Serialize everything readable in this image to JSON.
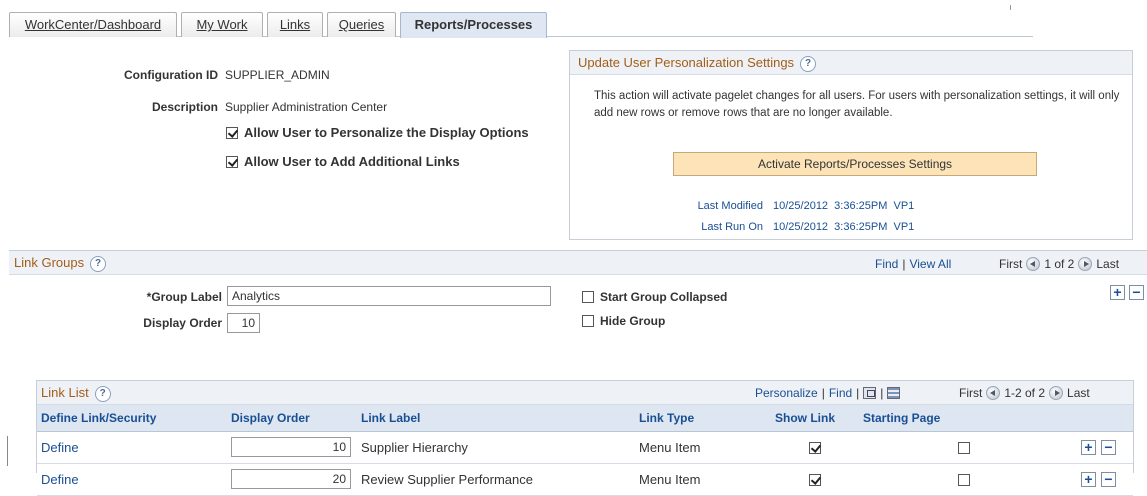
{
  "tabs": [
    {
      "label": "WorkCenter/Dashboard",
      "active": false
    },
    {
      "label": "My Work",
      "active": false
    },
    {
      "label": "Links",
      "active": false
    },
    {
      "label": "Queries",
      "active": false
    },
    {
      "label": "Reports/Processes",
      "active": true
    }
  ],
  "config": {
    "config_id_label": "Configuration ID",
    "config_id_value": "SUPPLIER_ADMIN",
    "description_label": "Description",
    "description_value": "Supplier Administration Center",
    "allow_personalize_label": "Allow User to Personalize the Display Options",
    "allow_personalize_checked": true,
    "allow_links_label": "Allow User to Add Additional Links",
    "allow_links_checked": true
  },
  "update": {
    "title": "Update User Personalization Settings",
    "help": "?",
    "description": "This action will activate pagelet changes for all users.  For users with personalization settings, it will only add new rows or remove rows that are no longer available.",
    "button_label": "Activate Reports/Processes Settings",
    "last_modified_label": "Last Modified",
    "last_modified_value": "10/25/2012  3:36:25PM  VP1",
    "last_run_label": "Last Run On",
    "last_run_value": "10/25/2012  3:36:25PM  VP1"
  },
  "link_groups": {
    "title": "Link Groups",
    "help": "?",
    "find": "Find",
    "view_all": "View All",
    "first": "First",
    "counter": "1 of 2",
    "last": "Last",
    "group_label_label": "*Group Label",
    "group_label_value": "Analytics",
    "display_order_label": "Display Order",
    "display_order_value": "10",
    "start_collapsed_label": "Start Group Collapsed",
    "start_collapsed_checked": false,
    "hide_group_label": "Hide Group",
    "hide_group_checked": false,
    "add": "+",
    "remove": "−"
  },
  "link_list": {
    "title": "Link List",
    "help": "?",
    "personalize": "Personalize",
    "find": "Find",
    "first": "First",
    "counter": "1-2 of 2",
    "last": "Last",
    "columns": [
      "Define Link/Security",
      "Display Order",
      "Link Label",
      "Link Type",
      "Show Link",
      "Starting Page"
    ],
    "rows": [
      {
        "define": "Define",
        "order": "10",
        "label": "Supplier Hierarchy",
        "type": "Menu Item",
        "show": true,
        "start": false
      },
      {
        "define": "Define",
        "order": "20",
        "label": "Review Supplier Performance",
        "type": "Menu Item",
        "show": true,
        "start": false
      }
    ],
    "add": "+",
    "remove": "−"
  }
}
